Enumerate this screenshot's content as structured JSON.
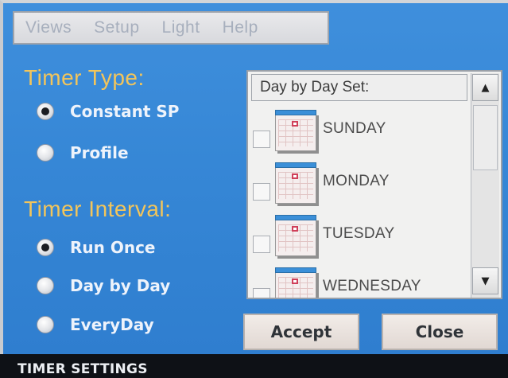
{
  "menu": {
    "items": [
      "Views",
      "Setup",
      "Light",
      "Help"
    ]
  },
  "timer_type": {
    "heading": "Timer Type:",
    "options": [
      {
        "label": "Constant SP",
        "checked": true
      },
      {
        "label": "Profile",
        "checked": false
      }
    ]
  },
  "timer_interval": {
    "heading": "Timer Interval:",
    "options": [
      {
        "label": "Run Once",
        "checked": true
      },
      {
        "label": "Day by Day",
        "checked": false
      },
      {
        "label": "EveryDay",
        "checked": false
      }
    ]
  },
  "day_list": {
    "header": "Day by Day Set:",
    "days": [
      {
        "label": "SUNDAY",
        "checked": false
      },
      {
        "label": "MONDAY",
        "checked": false
      },
      {
        "label": "TUESDAY",
        "checked": false
      },
      {
        "label": "WEDNESDAY",
        "checked": false
      }
    ],
    "scroll_up_icon": "triangle-up",
    "scroll_down_icon": "triangle-down"
  },
  "buttons": {
    "accept": "Accept",
    "close": "Close"
  },
  "status": {
    "title": "TIMER SETTINGS"
  },
  "colors": {
    "background": "#3687d6",
    "heading": "#f2c55b",
    "label": "#eef3fb"
  }
}
